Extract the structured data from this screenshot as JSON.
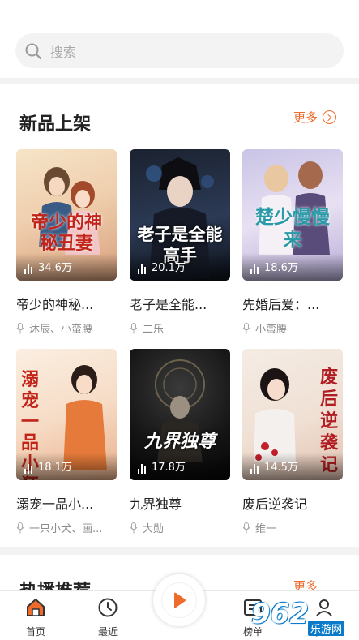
{
  "search": {
    "placeholder": "搜索"
  },
  "new_arrivals": {
    "title": "新品上架",
    "more_label": "更多",
    "books": [
      {
        "cover_title": "帝少的神秘丑妻",
        "plays": "34.6万",
        "title": "帝少的神秘...",
        "author": "沐辰、小蛮腰"
      },
      {
        "cover_title": "老子是全能高手",
        "plays": "20.1万",
        "title": "老子是全能...",
        "author": "二乐"
      },
      {
        "cover_title": "楚少慢慢来",
        "plays": "18.6万",
        "title": "先婚后爱：...",
        "author": "小蛮腰"
      },
      {
        "cover_title": "溺宠一品小狂妻",
        "plays": "18.1万",
        "title": "溺宠一品小...",
        "author": "一只小犬、画..."
      },
      {
        "cover_title": "九界独尊",
        "plays": "17.8万",
        "title": "九界独尊",
        "author": "大勋"
      },
      {
        "cover_title": "废后逆袭记",
        "plays": "14.5万",
        "title": "废后逆袭记",
        "author": "维一"
      }
    ]
  },
  "hot_section": {
    "title": "热播推荐",
    "more_label": "更多"
  },
  "tabbar": {
    "home": "首页",
    "recent": "最近",
    "rank": "榜单",
    "mine": "我的"
  },
  "watermark": {
    "logo": "962",
    "domain": "乐游网"
  },
  "colors": {
    "accent": "#ee6b2c",
    "bg": "#f2f2f2"
  }
}
